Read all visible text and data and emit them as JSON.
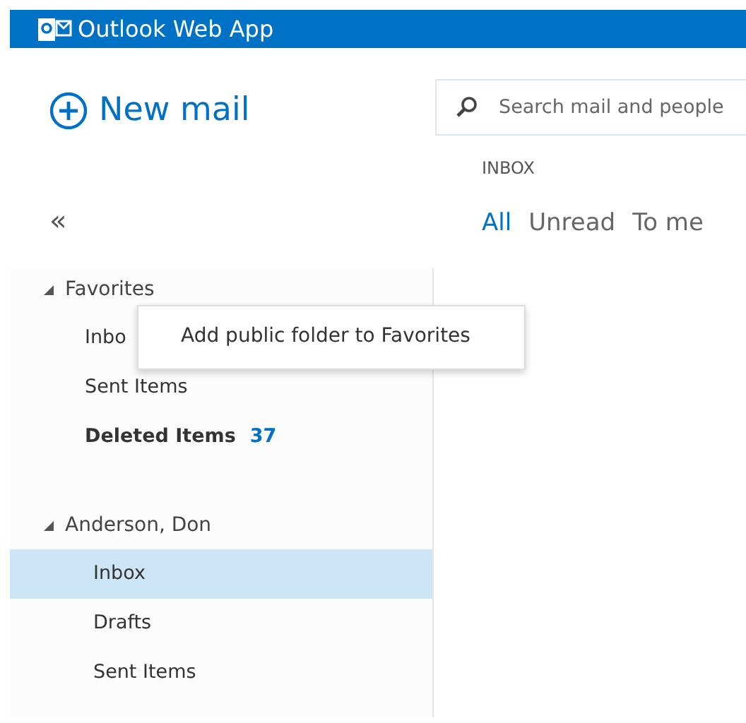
{
  "app": {
    "title": "Outlook Web App"
  },
  "new_mail": {
    "label": "New mail"
  },
  "search": {
    "placeholder": "Search mail and people"
  },
  "folder_heading": "INBOX",
  "collapse": {
    "label": "«"
  },
  "filters": [
    {
      "label": "All",
      "selected": true
    },
    {
      "label": "Unread",
      "selected": false
    },
    {
      "label": "To me",
      "selected": false
    }
  ],
  "tree": [
    {
      "label": "Favorites",
      "expanded": true,
      "children": [
        {
          "label": "Inbo",
          "selected": false,
          "unread": false
        },
        {
          "label": "Sent Items",
          "selected": false,
          "unread": false
        },
        {
          "label": "Deleted Items",
          "selected": false,
          "unread": true,
          "count": "37"
        }
      ]
    },
    {
      "label": "Anderson, Don",
      "expanded": true,
      "children": [
        {
          "label": "Inbox",
          "selected": true,
          "unread": false
        },
        {
          "label": "Drafts",
          "selected": false,
          "unread": false
        },
        {
          "label": "Sent Items",
          "selected": false,
          "unread": false
        }
      ]
    }
  ],
  "context_menu": {
    "items": [
      "Add public folder to Favorites"
    ]
  }
}
